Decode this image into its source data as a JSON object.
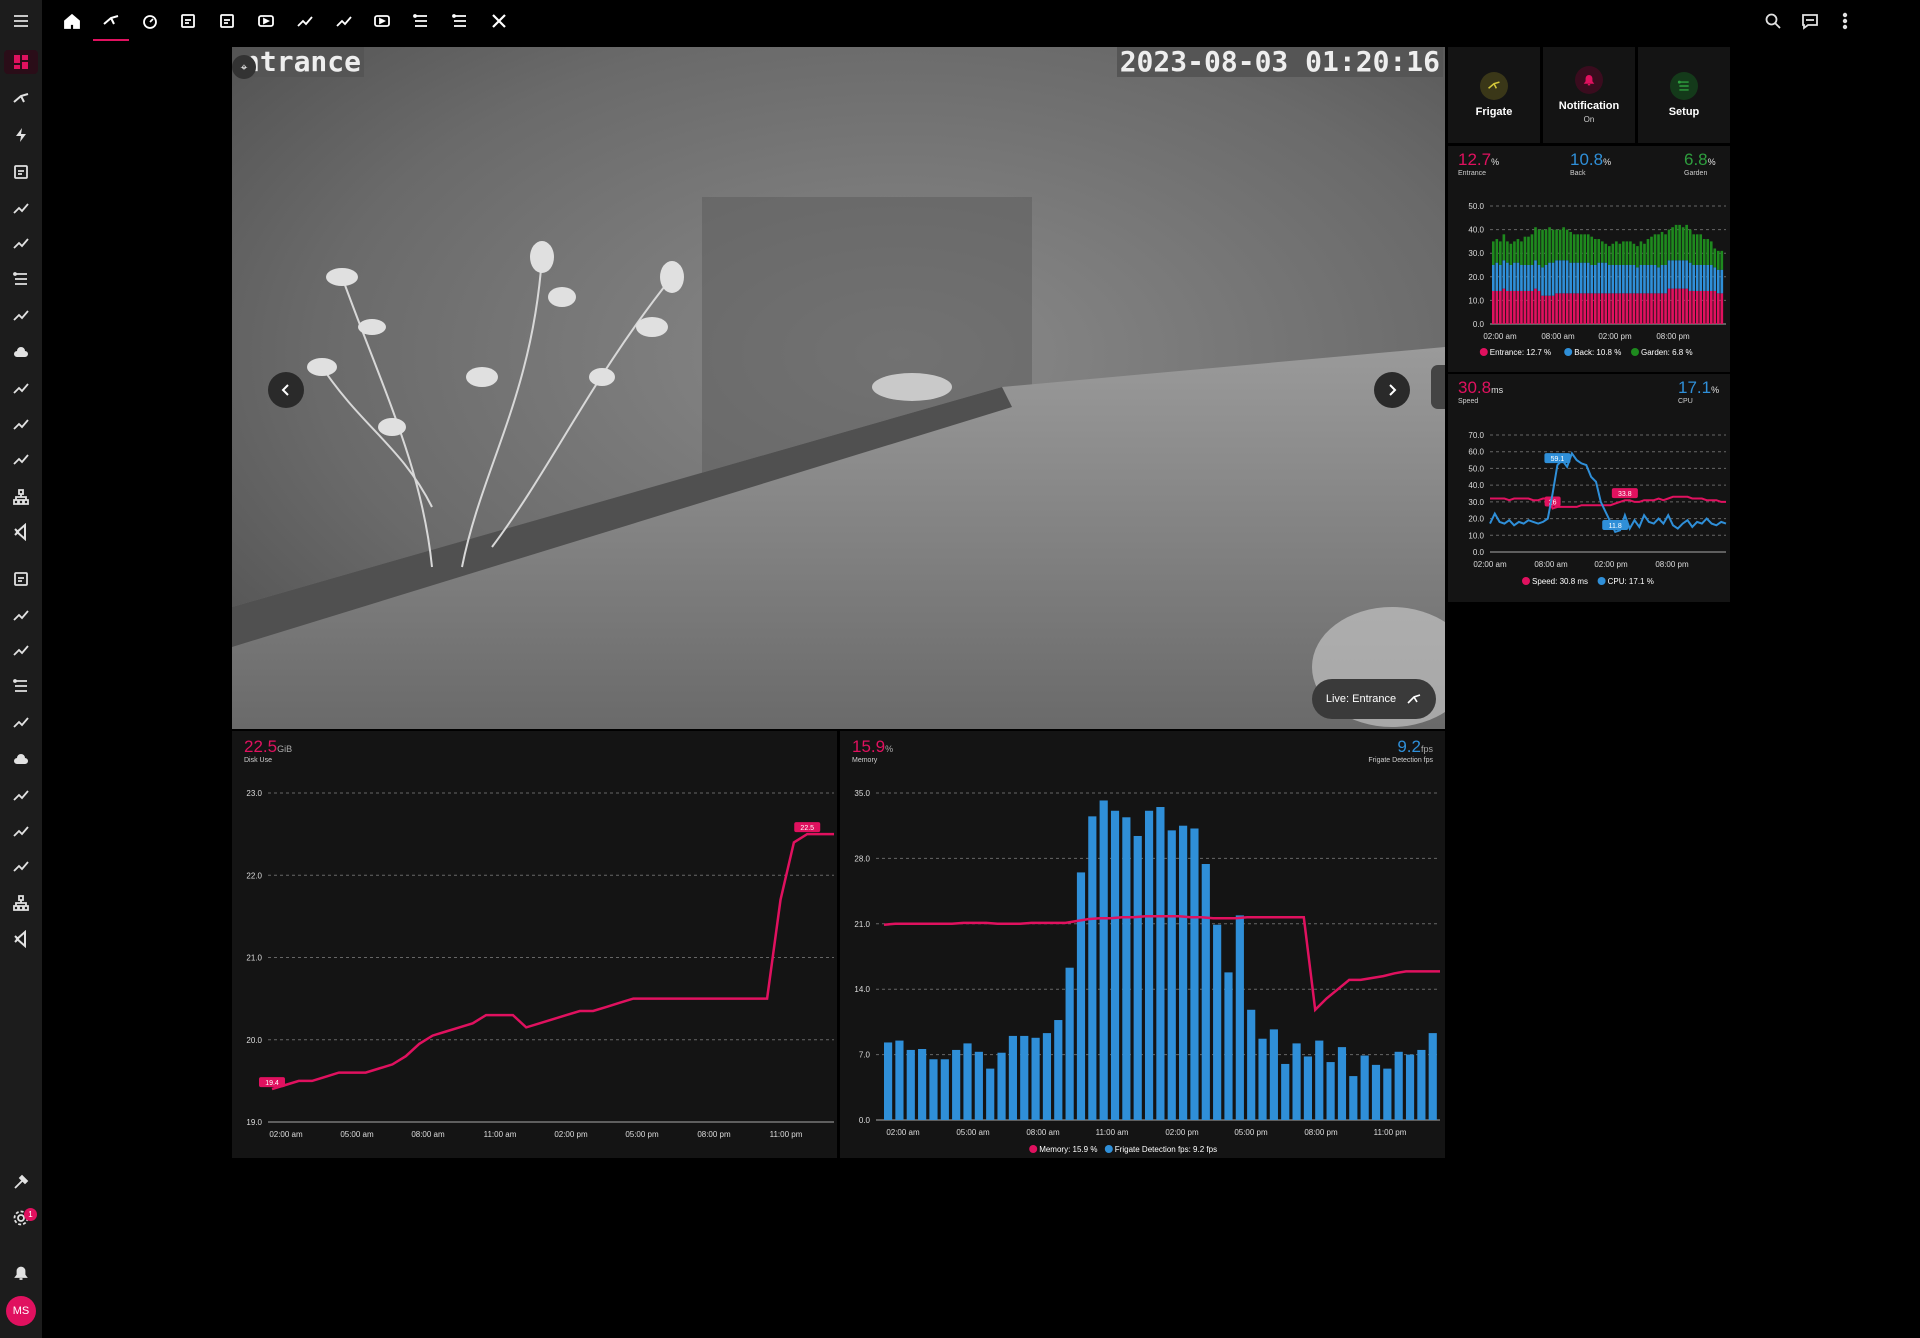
{
  "topbar": {
    "menu_icon": "menu-icon",
    "views": [
      "home-icon",
      "cctv-icon",
      "satellite-icon",
      "weather-icon",
      "network-icon",
      "server-icon",
      "chart-icon",
      "video-icon",
      "switch-icon",
      "book-icon",
      "tree-icon",
      "tools-icon"
    ],
    "active_view": 1,
    "right_icons": [
      "search-icon",
      "assist-icon",
      "more-icon"
    ]
  },
  "sidebar": {
    "items": [
      "dashboard-icon",
      "cctv-icon",
      "energy-icon",
      "logbook-icon",
      "speedometer-icon",
      "badge-icon",
      "list-icon",
      "chart-icon",
      "cloud-icon",
      "store-icon",
      "trend-icon",
      "media-icon",
      "sitemap-icon",
      "vscode-icon",
      "logbook-icon",
      "speedometer-icon",
      "badge-icon",
      "list-icon",
      "chart-icon",
      "cloud-icon",
      "store-icon",
      "trend-icon",
      "media-icon",
      "sitemap-icon",
      "vscode-icon"
    ],
    "bottom": {
      "dev_tools": "hammer-icon",
      "settings": "gear-icon",
      "settings_badge": "1",
      "notifications": "bell-icon",
      "user_initials": "MS"
    }
  },
  "camera": {
    "name_overlay": "ntrance",
    "timestamp": "2023-08-03 01:20:16",
    "live_label": "Live: Entrance",
    "prev_icon": "chevron-left-icon",
    "next_icon": "chevron-right-icon"
  },
  "buttons": [
    {
      "label": "Frigate",
      "state": "",
      "icon": "cctv-icon",
      "color": "#d4c83a",
      "bg": "#3a3718"
    },
    {
      "label": "Notification",
      "state": "On",
      "icon": "bell-icon",
      "color": "#e0115f",
      "bg": "#3a0c1e"
    },
    {
      "label": "Setup",
      "state": "",
      "icon": "file-icon",
      "color": "#2e9e3e",
      "bg": "#143a1a"
    }
  ],
  "cpu_card": {
    "stats": [
      {
        "value": "12.7",
        "unit": "%",
        "label": "Entrance",
        "color": "#e0115f"
      },
      {
        "value": "10.8",
        "unit": "%",
        "label": "Back",
        "color": "#2f8fd8"
      },
      {
        "value": "6.8",
        "unit": "%",
        "label": "Garden",
        "color": "#2e9e3e"
      }
    ],
    "legend": [
      "Entrance: 12.7 %",
      "Back: 10.8 %",
      "Garden: 6.8 %"
    ]
  },
  "speed_card": {
    "stats": [
      {
        "value": "30.8",
        "unit": "ms",
        "label": "Speed",
        "color": "#e0115f"
      },
      {
        "value": "17.1",
        "unit": "%",
        "label": "CPU",
        "color": "#2f8fd8"
      }
    ],
    "legend": [
      "Speed: 30.8 ms",
      "CPU: 17.1 %"
    ]
  },
  "disk_card": {
    "value": "22.5",
    "unit": "GiB",
    "label": "Disk Use",
    "color": "#e0115f"
  },
  "memory_card": {
    "left": {
      "value": "15.9",
      "unit": "%",
      "label": "Memory",
      "color": "#e0115f"
    },
    "right": {
      "value": "9.2",
      "unit": "fps",
      "label": "Frigate Detection fps",
      "color": "#2f8fd8"
    },
    "legend": [
      "Memory: 15.9 %",
      "Frigate Detection fps: 9.2 fps"
    ]
  },
  "colors": {
    "accent": "#e0115f",
    "blue": "#2f8fd8",
    "green": "#1e8a1e",
    "card": "#141414"
  },
  "chart_data": [
    {
      "id": "camera-cpu",
      "type": "bar",
      "stacked": true,
      "ylim": [
        0,
        50
      ],
      "yticks": [
        "0.0",
        "10.0",
        "20.0",
        "30.0",
        "40.0",
        "50.0"
      ],
      "xticks": [
        "02:00 am",
        "08:00 am",
        "02:00 pm",
        "08:00 pm"
      ],
      "series": [
        {
          "name": "Entrance",
          "color": "#e0115f",
          "values": [
            14,
            14,
            14,
            15,
            14,
            14,
            14,
            14,
            14,
            14,
            14,
            14,
            15,
            14,
            12,
            12,
            12,
            12,
            13,
            13,
            13,
            13,
            13,
            13,
            13,
            13,
            13,
            13,
            13,
            13,
            13,
            13,
            13,
            13,
            13,
            13,
            13,
            13,
            13,
            13,
            13,
            13,
            13,
            13,
            13,
            13,
            13,
            13,
            13,
            13,
            15,
            15,
            15,
            15,
            15,
            15,
            14,
            14,
            14,
            14,
            14,
            14,
            14,
            14,
            13,
            13
          ]
        },
        {
          "name": "Back",
          "color": "#2f8fd8",
          "values": [
            11,
            12,
            11,
            12,
            12,
            11,
            12,
            12,
            11,
            11,
            11,
            11,
            12,
            11,
            12,
            13,
            14,
            14,
            14,
            14,
            14,
            14,
            13,
            13,
            13,
            13,
            13,
            13,
            12,
            12,
            13,
            13,
            13,
            12,
            12,
            12,
            12,
            12,
            12,
            12,
            12,
            11,
            12,
            12,
            12,
            12,
            12,
            11,
            12,
            12,
            12,
            12,
            12,
            12,
            12,
            12,
            12,
            11,
            11,
            11,
            11,
            11,
            11,
            10,
            10,
            10
          ]
        },
        {
          "name": "Garden",
          "color": "#1e8a1e",
          "values": [
            10,
            10,
            10,
            11,
            9,
            9,
            9,
            10,
            10,
            12,
            12,
            13,
            14,
            15,
            16,
            15,
            15,
            14,
            13,
            13,
            14,
            13,
            13,
            12,
            12,
            12,
            12,
            12,
            12,
            11,
            10,
            9,
            8,
            8,
            9,
            10,
            9,
            10,
            10,
            10,
            9,
            9,
            10,
            9,
            11,
            12,
            13,
            14,
            14,
            13,
            13,
            14,
            15,
            15,
            14,
            15,
            14,
            13,
            13,
            13,
            11,
            11,
            10,
            8,
            8,
            8
          ]
        }
      ]
    },
    {
      "id": "speed-cpu",
      "type": "line",
      "ylim": [
        0,
        70
      ],
      "yticks": [
        "0.0",
        "10.0",
        "20.0",
        "30.0",
        "40.0",
        "50.0",
        "60.0",
        "70.0"
      ],
      "xticks": [
        "02:00 am",
        "08:00 am",
        "02:00 pm",
        "08:00 pm"
      ],
      "series": [
        {
          "name": "Speed",
          "color": "#e0115f",
          "labels": [
            {
              "i": 13,
              "text": "26"
            },
            {
              "i": 28,
              "text": "33.8"
            }
          ],
          "values": [
            32,
            32,
            32,
            32,
            31,
            32,
            32,
            32,
            32,
            31,
            31,
            32,
            32,
            26,
            27,
            27,
            27,
            27,
            27,
            28,
            28,
            28,
            28,
            28,
            28,
            28,
            29,
            30,
            31,
            31,
            30,
            30,
            31,
            31,
            31,
            32,
            31,
            32,
            33,
            33,
            33,
            33,
            32,
            32,
            32,
            31,
            31,
            31,
            30,
            30
          ]
        },
        {
          "name": "CPU",
          "color": "#2f8fd8",
          "labels": [
            {
              "i": 14,
              "text": "59.1"
            },
            {
              "i": 26,
              "text": "11.8"
            }
          ],
          "values": [
            17,
            23,
            18,
            17,
            19,
            16,
            18,
            17,
            19,
            18,
            17,
            18,
            20,
            35,
            52,
            55,
            51,
            59,
            55,
            53,
            52,
            45,
            42,
            30,
            24,
            18,
            12,
            13,
            22,
            14,
            19,
            15,
            22,
            18,
            17,
            20,
            17,
            22,
            16,
            14,
            17,
            19,
            15,
            18,
            17,
            20,
            17,
            16,
            18,
            17
          ]
        }
      ]
    },
    {
      "id": "disk-use",
      "type": "line",
      "ylim": [
        19.0,
        23.0
      ],
      "yticks": [
        "19.0",
        "20.0",
        "21.0",
        "22.0",
        "23.0"
      ],
      "xticks": [
        "02:00 am",
        "05:00 am",
        "08:00 am",
        "11:00 am",
        "02:00 pm",
        "05:00 pm",
        "08:00 pm",
        "11:00 pm"
      ],
      "labels": [
        {
          "i": 0,
          "text": "19.4"
        },
        {
          "i": 40,
          "text": "22.5"
        }
      ],
      "series": [
        {
          "name": "Disk Use",
          "color": "#e0115f",
          "values": [
            19.4,
            19.45,
            19.5,
            19.5,
            19.55,
            19.6,
            19.6,
            19.6,
            19.65,
            19.7,
            19.8,
            19.95,
            20.05,
            20.1,
            20.15,
            20.2,
            20.3,
            20.3,
            20.3,
            20.15,
            20.2,
            20.25,
            20.3,
            20.35,
            20.35,
            20.4,
            20.45,
            20.5,
            20.5,
            20.5,
            20.5,
            20.5,
            20.5,
            20.5,
            20.5,
            20.5,
            20.5,
            20.5,
            21.7,
            22.4,
            22.5,
            22.5,
            22.5
          ]
        }
      ]
    },
    {
      "id": "memory-fps",
      "type": "bar",
      "ylim": [
        0,
        35
      ],
      "yticks": [
        "0.0",
        "7.0",
        "14.0",
        "21.0",
        "28.0",
        "35.0"
      ],
      "xticks": [
        "02:00 am",
        "05:00 am",
        "08:00 am",
        "11:00 am",
        "02:00 pm",
        "05:00 pm",
        "08:00 pm",
        "11:00 pm"
      ],
      "series": [
        {
          "name": "Frigate Detection fps",
          "color": "#2f8fd8",
          "values": [
            8.3,
            8.5,
            7.5,
            7.6,
            6.5,
            6.5,
            7.5,
            8.2,
            7.3,
            5.5,
            7.2,
            9.0,
            9.0,
            8.8,
            9.3,
            10.7,
            16.3,
            26.5,
            32.5,
            34.2,
            33.1,
            32.4,
            30.4,
            33.1,
            33.5,
            31.0,
            31.5,
            31.2,
            27.4,
            20.9,
            15.8,
            21.9,
            11.8,
            8.7,
            9.7,
            6.0,
            8.2,
            6.8,
            8.5,
            6.2,
            7.8,
            4.7,
            6.9,
            5.9,
            5.5,
            7.3,
            7.0,
            7.5,
            9.3
          ]
        },
        {
          "name": "Memory",
          "color": "#e0115f",
          "type": "line",
          "values": [
            20.9,
            21.0,
            21.0,
            21.0,
            21.0,
            21.0,
            21.0,
            21.1,
            21.1,
            21.1,
            21.0,
            21.0,
            21.0,
            21.1,
            21.1,
            21.1,
            21.1,
            21.3,
            21.5,
            21.6,
            21.6,
            21.7,
            21.7,
            21.8,
            21.8,
            21.8,
            21.8,
            21.7,
            21.7,
            21.6,
            21.6,
            21.6,
            21.7,
            21.7,
            21.7,
            21.7,
            21.7,
            21.7,
            11.8,
            13.0,
            14.0,
            15.0,
            15.0,
            15.2,
            15.4,
            15.7,
            15.9,
            15.9,
            15.9,
            15.9
          ]
        }
      ]
    }
  ]
}
